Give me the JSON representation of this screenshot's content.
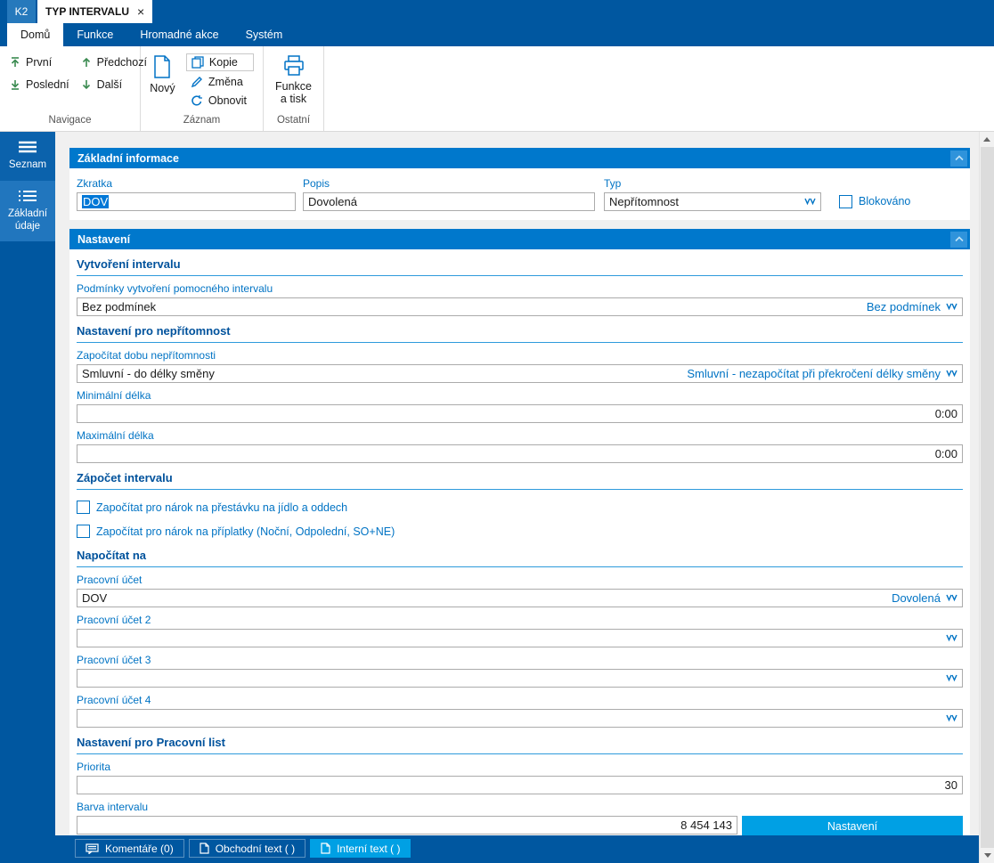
{
  "titlebar": {
    "app_tab": "K2",
    "doc_tab": "TYP INTERVALU",
    "close": "×"
  },
  "ribbon": {
    "tabs": [
      "Domů",
      "Funkce",
      "Hromadné akce",
      "Systém"
    ],
    "nav": {
      "first": "První",
      "last": "Poslední",
      "prev": "Předchozí",
      "next": "Další"
    },
    "record": {
      "new": "Nový",
      "copy": "Kopie",
      "change": "Změna",
      "refresh": "Obnovit"
    },
    "other": {
      "print": "Funkce a tisk"
    },
    "group_labels": {
      "navigace": "Navigace",
      "zaznam": "Záznam",
      "ostatni": "Ostatní"
    }
  },
  "sidebar": {
    "items": [
      {
        "label": "Seznam"
      },
      {
        "label": "Základní údaje"
      }
    ]
  },
  "basic_panel": {
    "title": "Základní informace",
    "zkratka": {
      "label": "Zkratka",
      "value": "DOV"
    },
    "popis": {
      "label": "Popis",
      "value": "Dovolená"
    },
    "typ": {
      "label": "Typ",
      "value": "Nepřítomnost"
    },
    "blokovano": {
      "label": "Blokováno"
    }
  },
  "settings_panel": {
    "title": "Nastavení",
    "sec_vytvoreni": "Vytvoření intervalu",
    "podminky": {
      "label": "Podmínky vytvoření pomocného intervalu",
      "value": "Bez podmínek",
      "desc": "Bez podmínek"
    },
    "sec_nepritomnost": "Nastavení pro nepřítomnost",
    "zapocitat": {
      "label": "Započítat dobu nepřítomnosti",
      "value": "Smluvní - do délky směny",
      "desc": "Smluvní - nezapočítat při překročení délky směny"
    },
    "min_delka": {
      "label": "Minimální délka",
      "value": "0:00"
    },
    "max_delka": {
      "label": "Maximální délka",
      "value": "0:00"
    },
    "sec_zapocet": "Zápočet intervalu",
    "chk_prestavka": {
      "label": "Započítat pro nárok na přestávku na jídlo a oddech"
    },
    "chk_priplatky": {
      "label": "Započítat pro nárok na příplatky (Noční, Odpolední, SO+NE)"
    },
    "sec_napocitat": "Napočítat na",
    "ucet1": {
      "label": "Pracovní účet",
      "value": "DOV",
      "desc": "Dovolená"
    },
    "ucet2": {
      "label": "Pracovní účet 2",
      "value": "",
      "desc": ""
    },
    "ucet3": {
      "label": "Pracovní účet 3",
      "value": "",
      "desc": ""
    },
    "ucet4": {
      "label": "Pracovní účet 4",
      "value": "",
      "desc": ""
    },
    "sec_pracovni": "Nastavení pro Pracovní list",
    "priorita": {
      "label": "Priorita",
      "value": "30"
    },
    "barva": {
      "label": "Barva intervalu",
      "value": "8 454 143",
      "button": "Nastavení"
    }
  },
  "bottom_tabs": [
    {
      "label": "Komentáře (0)"
    },
    {
      "label": "Obchodní text ( )"
    },
    {
      "label": "Interní text ( )"
    }
  ],
  "colors": {
    "titlebar_blue": "#0057A0",
    "panel_header_blue": "#0078CC",
    "accent_blue": "#0073C4",
    "active_cyan": "#00A0E4",
    "selection_blue": "#0078D7"
  }
}
